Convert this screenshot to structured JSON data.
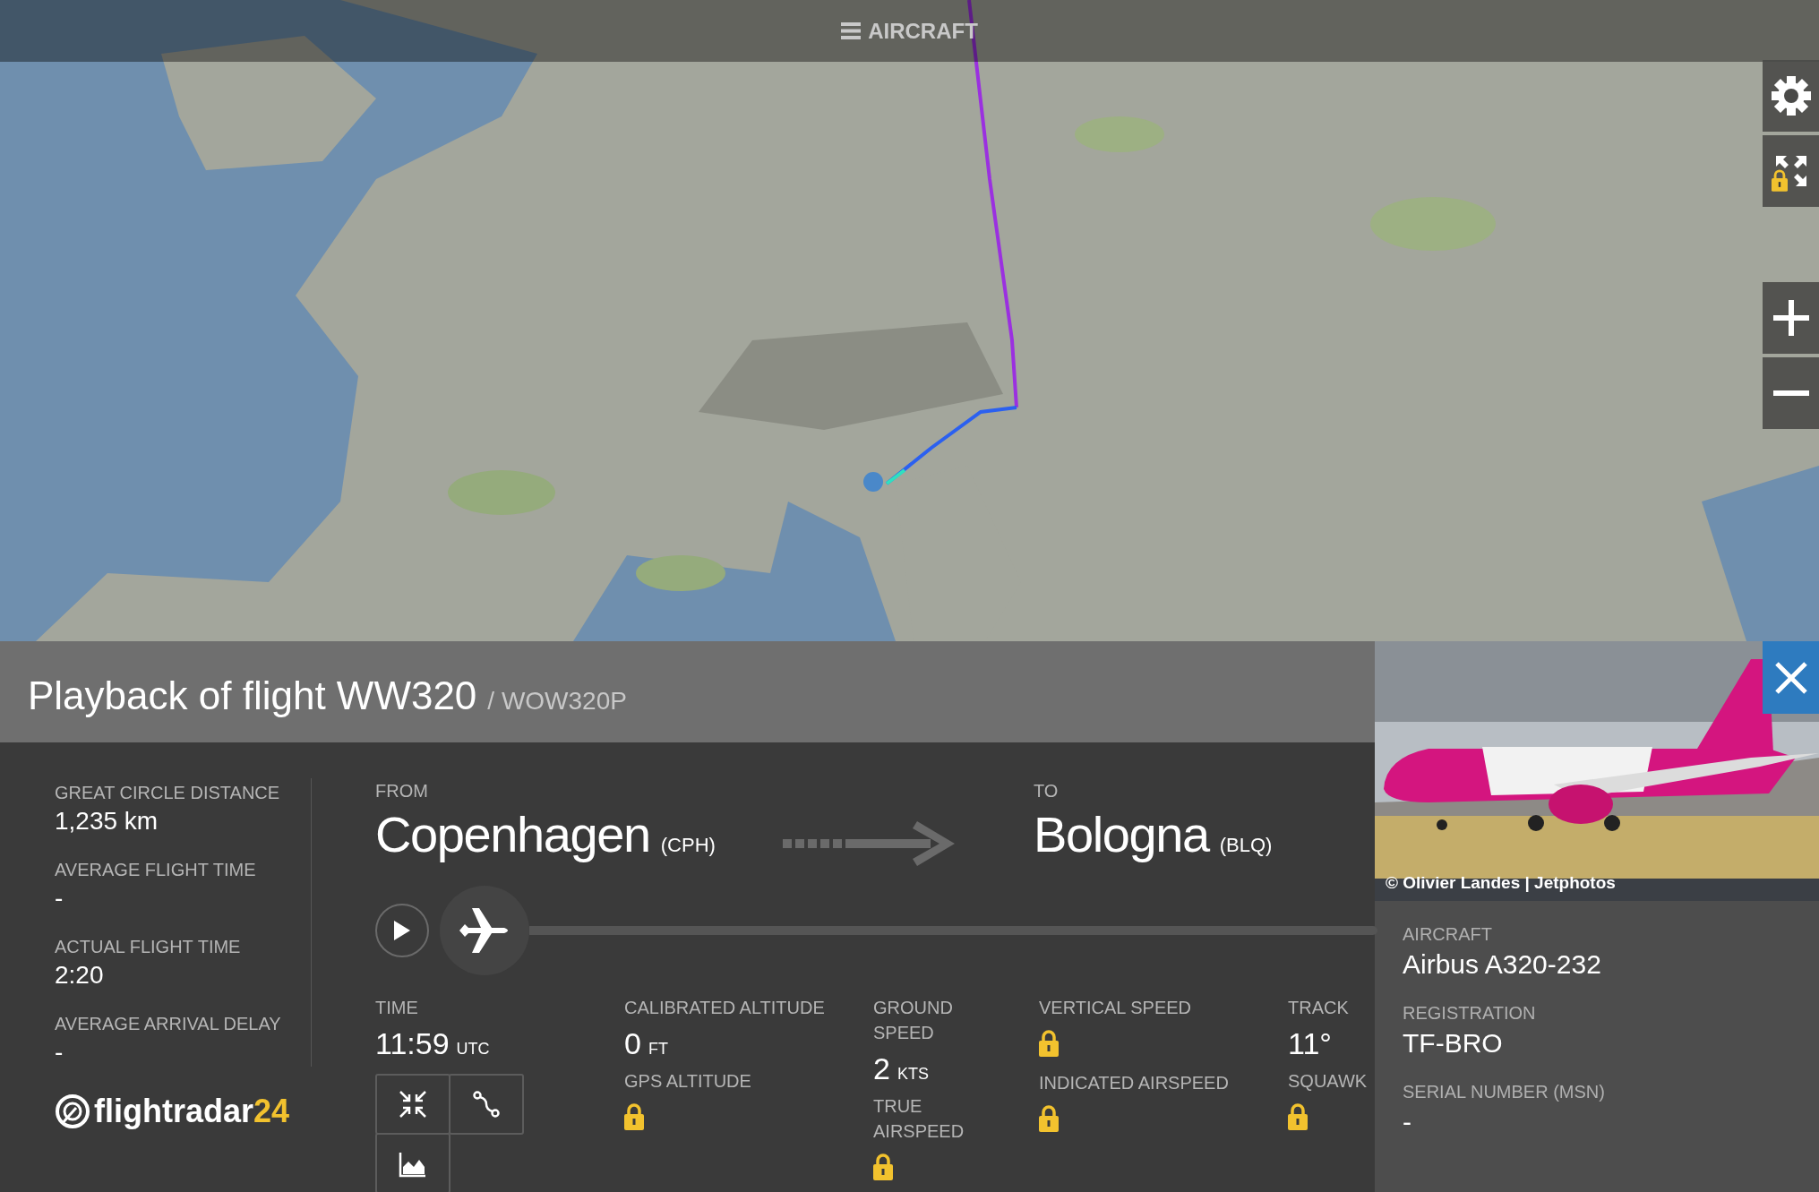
{
  "menu": {
    "label": "AIRCRAFT"
  },
  "map_controls": [
    {
      "kind": "settings",
      "locked": false
    },
    {
      "kind": "fullscreen",
      "locked": true
    },
    {
      "kind": "zoom-in",
      "locked": false
    },
    {
      "kind": "zoom-out",
      "locked": false
    }
  ],
  "header": {
    "title": "Playback of flight WW320",
    "subtitle": "/ WOW320P"
  },
  "summary": [
    {
      "label": "GREAT CIRCLE DISTANCE",
      "value": "1,235 km"
    },
    {
      "label": "AVERAGE FLIGHT TIME",
      "value": "-"
    },
    {
      "label": "ACTUAL FLIGHT TIME",
      "value": "2:20"
    },
    {
      "label": "AVERAGE ARRIVAL DELAY",
      "value": "-"
    }
  ],
  "logo": {
    "text": "flightradar",
    "accent": "24"
  },
  "route": {
    "from": {
      "label": "FROM",
      "city": "Copenhagen",
      "code": "(CPH)"
    },
    "to": {
      "label": "TO",
      "city": "Bologna",
      "code": "(BLQ)"
    }
  },
  "playback": {
    "playing": false,
    "level": 0
  },
  "stats": [
    {
      "items": [
        {
          "kind": "value",
          "label": "TIME",
          "value": "11:59",
          "unit": "UTC"
        }
      ]
    },
    {
      "items": [
        {
          "kind": "value",
          "label": "CALIBRATED ALTITUDE",
          "value": "0",
          "unit": "FT"
        },
        {
          "kind": "locked",
          "label": "GPS ALTITUDE"
        }
      ]
    },
    {
      "items": [
        {
          "kind": "value",
          "label": "GROUND SPEED",
          "value": "2",
          "unit": "KTS"
        },
        {
          "kind": "locked",
          "label": "TRUE AIRSPEED"
        }
      ]
    },
    {
      "items": [
        {
          "kind": "locked",
          "label": "VERTICAL SPEED"
        },
        {
          "kind": "locked",
          "label": "INDICATED AIRSPEED"
        }
      ]
    },
    {
      "items": [
        {
          "kind": "value",
          "label": "TRACK",
          "value": "11°"
        },
        {
          "kind": "locked",
          "label": "SQUAWK"
        }
      ]
    }
  ],
  "view_buttons": [
    {
      "kind": "collapse"
    },
    {
      "kind": "route"
    },
    {
      "kind": "chart"
    }
  ],
  "aircraft_panel": {
    "photo": {
      "kind": "picture",
      "credit": "© Olivier Landes | Jetphotos"
    },
    "fields": [
      {
        "label": "AIRCRAFT",
        "value": "Airbus A320-232"
      },
      {
        "label": "REGISTRATION",
        "value": "TF-BRO"
      },
      {
        "label": "SERIAL NUMBER (MSN)",
        "value": "-"
      }
    ]
  }
}
